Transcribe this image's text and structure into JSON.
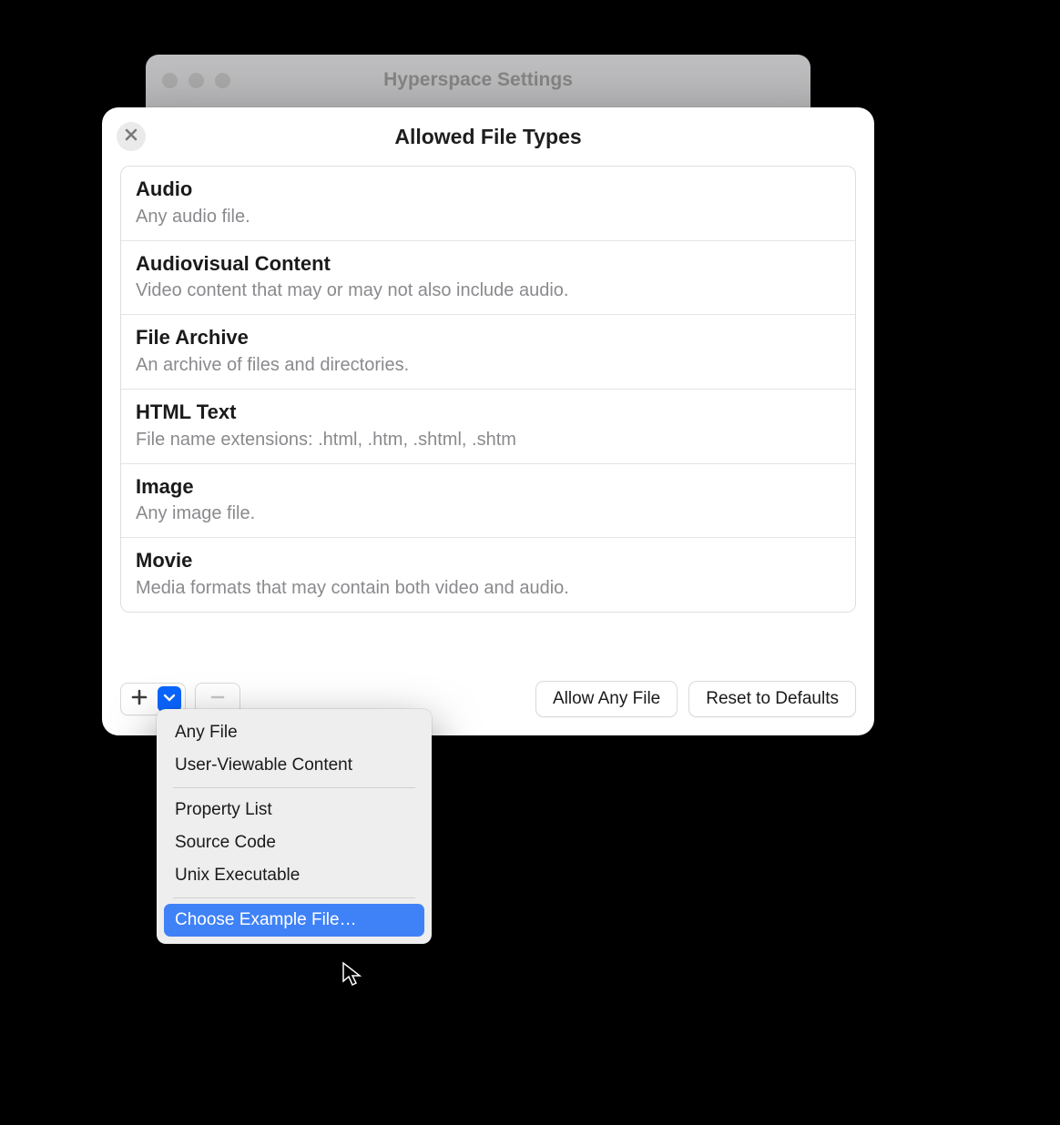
{
  "parentWindow": {
    "title": "Hyperspace Settings"
  },
  "sheet": {
    "title": "Allowed File Types",
    "rows": [
      {
        "title": "Audio",
        "desc": "Any audio file."
      },
      {
        "title": "Audiovisual Content",
        "desc": "Video content that may or may not also include audio."
      },
      {
        "title": "File Archive",
        "desc": "An archive of files and directories."
      },
      {
        "title": "HTML Text",
        "desc": "File name extensions: .html, .htm, .shtml, .shtm"
      },
      {
        "title": "Image",
        "desc": "Any image file."
      },
      {
        "title": "Movie",
        "desc": "Media formats that may contain both video and audio."
      }
    ],
    "buttons": {
      "allowAny": "Allow Any File",
      "reset": "Reset to Defaults"
    }
  },
  "menu": {
    "items": {
      "anyFile": "Any File",
      "userViewable": "User-Viewable Content",
      "propertyList": "Property List",
      "sourceCode": "Source Code",
      "unixExecutable": "Unix Executable",
      "chooseExample": "Choose Example File…"
    }
  }
}
